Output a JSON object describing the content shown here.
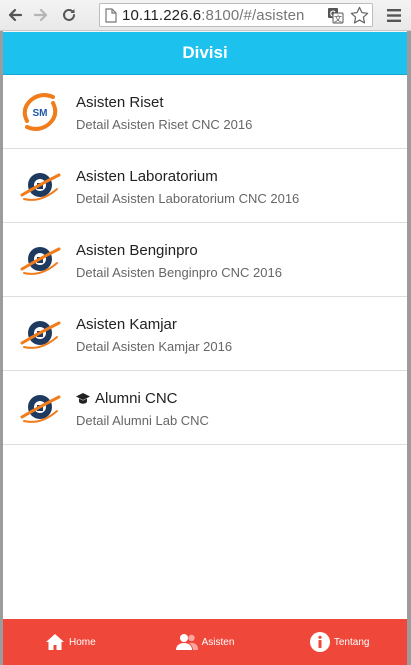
{
  "browser": {
    "url_host": "10.11.226.6",
    "url_rest": ":8100/#/asisten"
  },
  "header": {
    "title": "Divisi"
  },
  "items": [
    {
      "name": "Asisten Riset",
      "detail": "Detail Asisten Riset CNC 2016",
      "logo": "riset-logo"
    },
    {
      "name": "Asisten Laboratorium",
      "detail": "Detail Asisten Laboratorium CNC 2016",
      "logo": "cnc-logo"
    },
    {
      "name": "Asisten Benginpro",
      "detail": "Detail Asisten Benginpro CNC 2016",
      "logo": "cnc-logo"
    },
    {
      "name": "Asisten Kamjar",
      "detail": "Detail Asisten Kamjar 2016",
      "logo": "cnc-logo"
    },
    {
      "name": "Alumni CNC",
      "detail": "Detail Alumni Lab CNC",
      "logo": "cnc-logo",
      "icon": "graduation-cap-icon"
    }
  ],
  "tabs": [
    {
      "label": "Home",
      "icon": "home-icon"
    },
    {
      "label": "Asisten",
      "icon": "people-icon"
    },
    {
      "label": "Tentang",
      "icon": "info-icon"
    }
  ],
  "colors": {
    "header": "#1cc1ee",
    "tabbar": "#ef473a",
    "logo_orange": "#f07c1c",
    "logo_navy": "#1e3a5f"
  }
}
